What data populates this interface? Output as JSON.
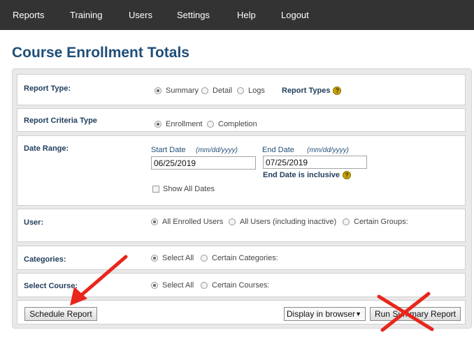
{
  "nav": {
    "items": [
      "Reports",
      "Training",
      "Users",
      "Settings",
      "Help",
      "Logout"
    ]
  },
  "page": {
    "title": "Course Enrollment Totals"
  },
  "report_type": {
    "label": "Report Type:",
    "options": [
      "Summary",
      "Detail",
      "Logs"
    ],
    "selected": "Summary",
    "help_link": "Report Types"
  },
  "criteria_type": {
    "label": "Report Criteria Type",
    "options": [
      "Enrollment",
      "Completion"
    ],
    "selected": "Enrollment"
  },
  "date_range": {
    "label": "Date Range:",
    "start_label": "Start Date",
    "start_hint": "(mm/dd/yyyy)",
    "start_value": "06/25/2019",
    "end_label": "End Date",
    "end_hint": "(mm/dd/yyyy)",
    "end_value": "07/25/2019",
    "inclusive_note": "End Date is inclusive",
    "show_all_label": "Show All Dates"
  },
  "user": {
    "label": "User:",
    "options": [
      "All Enrolled Users",
      "All Users (including inactive)",
      "Certain Groups:"
    ],
    "selected": "All Enrolled Users"
  },
  "categories": {
    "label": "Categories:",
    "options": [
      "Select All",
      "Certain Categories:"
    ],
    "selected": "Select All"
  },
  "select_course": {
    "label": "Select Course:",
    "options": [
      "Select All",
      "Certain Courses:"
    ],
    "selected": "Select All"
  },
  "actions": {
    "schedule_label": "Schedule Report",
    "display_select_value": "Display in browser",
    "run_label": "Run Summary Report"
  },
  "help_icon_glyph": "?",
  "annotations": {
    "arrow_color": "#e8261c",
    "cross_color": "#e8261c"
  }
}
